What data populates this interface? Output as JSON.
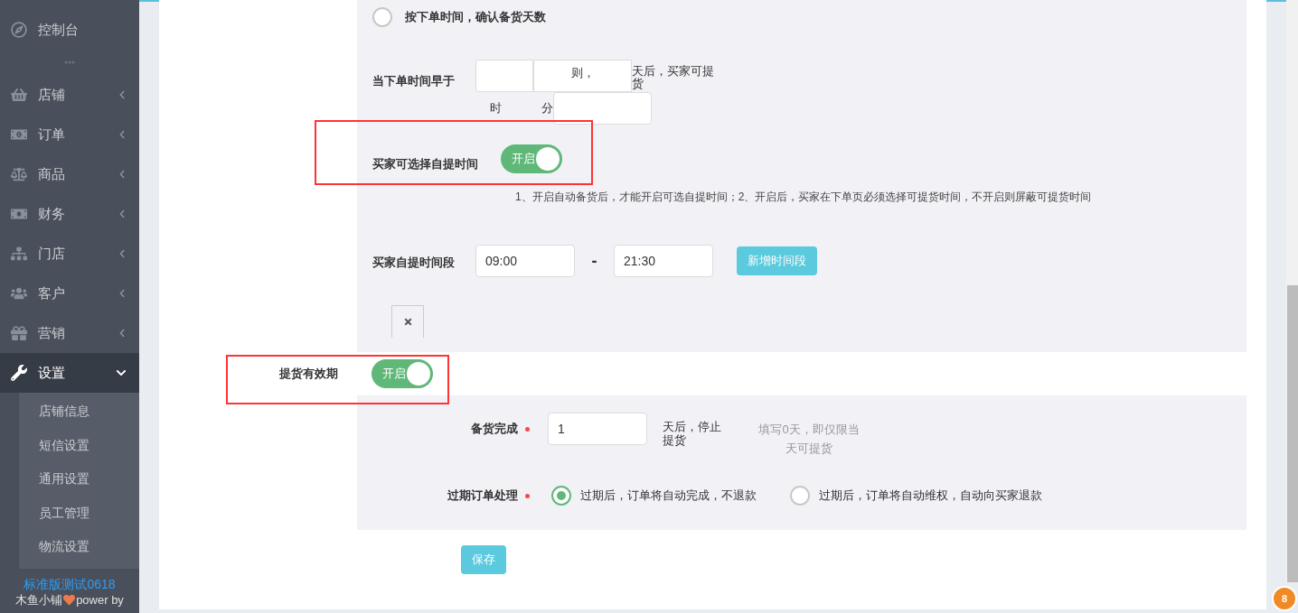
{
  "sidebar": {
    "items": [
      {
        "label": "控制台",
        "expandable": false,
        "selected": false
      },
      {
        "label": "店铺",
        "expandable": true,
        "selected": false
      },
      {
        "label": "订单",
        "expandable": true,
        "selected": false
      },
      {
        "label": "商品",
        "expandable": true,
        "selected": false
      },
      {
        "label": "财务",
        "expandable": true,
        "selected": false
      },
      {
        "label": "门店",
        "expandable": true,
        "selected": false
      },
      {
        "label": "客户",
        "expandable": true,
        "selected": false
      },
      {
        "label": "营销",
        "expandable": true,
        "selected": false
      },
      {
        "label": "设置",
        "expandable": true,
        "selected": true
      }
    ],
    "sub_items": [
      {
        "label": "店铺信息"
      },
      {
        "label": "短信设置"
      },
      {
        "label": "通用设置"
      },
      {
        "label": "员工管理"
      },
      {
        "label": "物流设置"
      }
    ],
    "footer": {
      "version": "标准版测试0618",
      "brand": "木鱼小铺",
      "power": "power by"
    }
  },
  "form": {
    "radio_option": {
      "label": "按下单时间，确认备货天数",
      "selected": false
    },
    "order_time": {
      "label": "当下单时间早于",
      "then": "则，",
      "after": "天后，买家可提货",
      "hour": "时",
      "minute": "分"
    },
    "buyer_choose": {
      "label": "买家可选择自提时间",
      "toggle": {
        "label": "开启",
        "on": true
      }
    },
    "note": "1、开启自动备货后，才能开启可选自提时间；2、开启后，买家在下单页必须选择可提货时间，不开启则屏蔽可提货时间",
    "time_range": {
      "label": "买家自提时间段",
      "start": "09:00",
      "separator": "-",
      "end": "21:30",
      "add_button": "新增时间段"
    },
    "validity": {
      "label": "提货有效期",
      "toggle": {
        "label": "开启",
        "on": true
      }
    },
    "stock_done": {
      "label": "备货完成",
      "required": true,
      "value": "1",
      "suffix": "天后，停止提货",
      "hint": "填写0天，即仅限当天可提货"
    },
    "expired": {
      "label": "过期订单处理",
      "required": true,
      "options": [
        {
          "label": "过期后，订单将自动完成，不退款",
          "selected": true
        },
        {
          "label": "过期后，订单将自动维权，自动向买家退款",
          "selected": false
        }
      ]
    },
    "save_button": "保存"
  },
  "corner_badge": "8"
}
